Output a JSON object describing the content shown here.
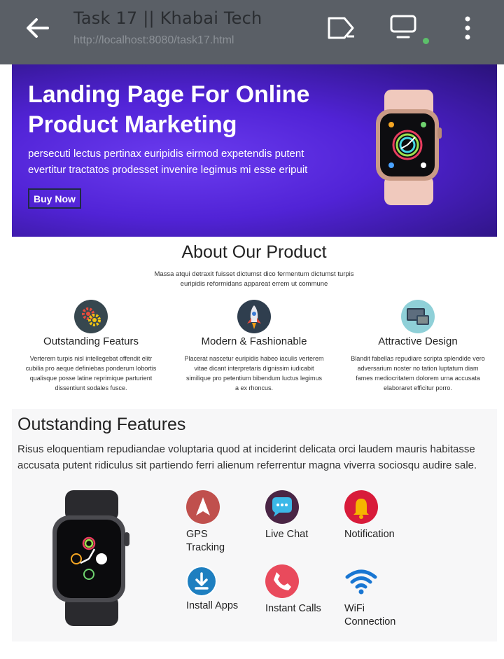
{
  "browser": {
    "tab_title": "Task 17 || Khabai Tech",
    "url": "http://localhost:8080/task17.html",
    "icons": [
      "back-arrow-icon",
      "cast-icon",
      "desktop-icon",
      "more-vert-icon"
    ],
    "status_dot_color": "#5cc06a"
  },
  "hero": {
    "title": "Landing Page For Online Product Marketing",
    "subtitle": "persecuti lectus pertinax euripidis eirmod expetendis putent evertitur tractatos prodesset invenire legimus mi esse eripuit",
    "button": "Buy Now"
  },
  "about": {
    "title": "About Our Product",
    "subtitle": "Massa atqui detraxit fuisset dictumst dico fermentum dictumst turpis euripidis reformidans appareat errem ut commune",
    "features": [
      {
        "icon": "gears-icon",
        "title": "Outstanding Featurs",
        "text": "Verterem turpis nisl intellegebat offendit elitr cubilia pro aeque definiebas ponderum lobortis qualisque posse latine reprimique parturient dissentiunt sodales fusce."
      },
      {
        "icon": "rocket-icon",
        "title": "Modern & Fashionable",
        "text": "Placerat nascetur euripidis habeo iaculis verterem vitae dicant interpretaris dignissim iudicabit similique pro petentium bibendum luctus legimus a ex rhoncus."
      },
      {
        "icon": "devices-icon",
        "title": "Attractive Design",
        "text": "Blandit fabellas repudiare scripta splendide vero adversarium noster no tation luptatum diam fames mediocritatem dolorem urna accusata elaboraret efficitur porro."
      }
    ]
  },
  "outstanding": {
    "title": "Outstanding Features",
    "text": "Risus eloquentiam repudiandae voluptaria quod at inciderint delicata orci laudem mauris habitasse accusata putent ridiculus sit partiendo ferri alienum referrentur magna viverra sociosqu audire sale.",
    "items": [
      {
        "icon": "gps-navigation-icon",
        "label": "GPS Tracking"
      },
      {
        "icon": "chat-bubble-icon",
        "label": "Live Chat"
      },
      {
        "icon": "bell-icon",
        "label": "Notification"
      },
      {
        "icon": "download-icon",
        "label": "Install Apps"
      },
      {
        "icon": "phone-icon",
        "label": "Instant Calls"
      },
      {
        "icon": "wifi-icon",
        "label": "WiFi Connection"
      }
    ]
  }
}
